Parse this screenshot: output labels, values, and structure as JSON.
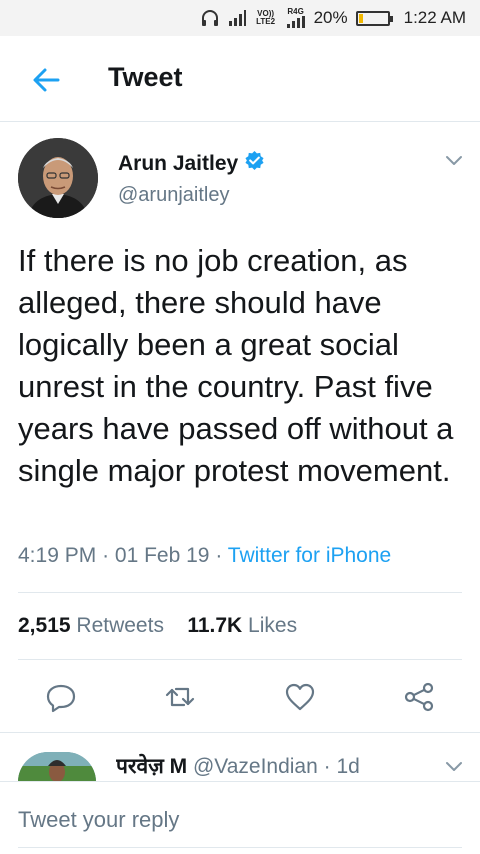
{
  "status_bar": {
    "signal_1_label": "VO)) LTE2",
    "signal_2_label": "R4G",
    "battery": "20%",
    "battery_level": 0.2,
    "time": "1:22 AM"
  },
  "header": {
    "title": "Tweet",
    "back_icon": "arrow-left-icon"
  },
  "tweet": {
    "author_name": "Arun Jaitley",
    "author_handle": "@arunjaitley",
    "verified": true,
    "text": "If there is no job creation, as alleged, there should have logically been a great social unrest in the country. Past five years have passed off without a single major protest movement.",
    "time": "4:19 PM",
    "date": "01 Feb 19",
    "separator": "·",
    "source": "Twitter for iPhone",
    "retweets_count": "2,515",
    "retweets_label": "Retweets",
    "likes_count": "11.7K",
    "likes_label": "Likes"
  },
  "actions": [
    "reply-icon",
    "retweet-icon",
    "like-icon",
    "share-icon"
  ],
  "reply_preview": {
    "name": "परवेज़ M",
    "handle": "@VazeIndian",
    "time": "· 1d"
  },
  "composer": {
    "placeholder": "Tweet your reply"
  },
  "colors": {
    "accent": "#1da1f2",
    "muted": "#657786",
    "text": "#14171a",
    "divider": "#e1e8ed"
  }
}
